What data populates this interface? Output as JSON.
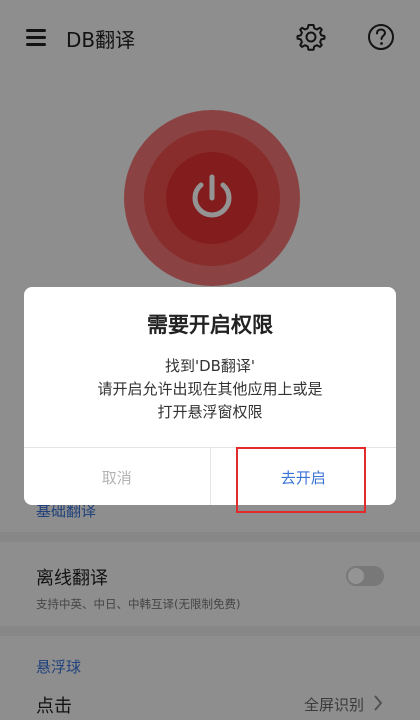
{
  "app": {
    "title": "DB翻译"
  },
  "colors": {
    "accent": "#3a73d6",
    "power_red": "#e23232",
    "highlight": "#e22b2b"
  },
  "icons": {
    "menu": "menu-icon",
    "settings": "gear-icon",
    "help": "help-circle-icon",
    "power": "power-icon",
    "chevron": "chevron-right-icon"
  },
  "sections": {
    "partial_link": "基础翻译",
    "offline": {
      "title": "离线翻译",
      "desc": "支持中英、中日、中韩互译(无限制免费)",
      "enabled": false
    },
    "float_ball": {
      "header": "悬浮球",
      "click_label": "点击",
      "click_value": "全屏识别"
    }
  },
  "dialog": {
    "title": "需要开启权限",
    "message_line1": "找到'DB翻译'",
    "message_line2": "请开启允许出现在其他应用上或是",
    "message_line3": "打开悬浮窗权限",
    "cancel_label": "取消",
    "confirm_label": "去开启"
  }
}
